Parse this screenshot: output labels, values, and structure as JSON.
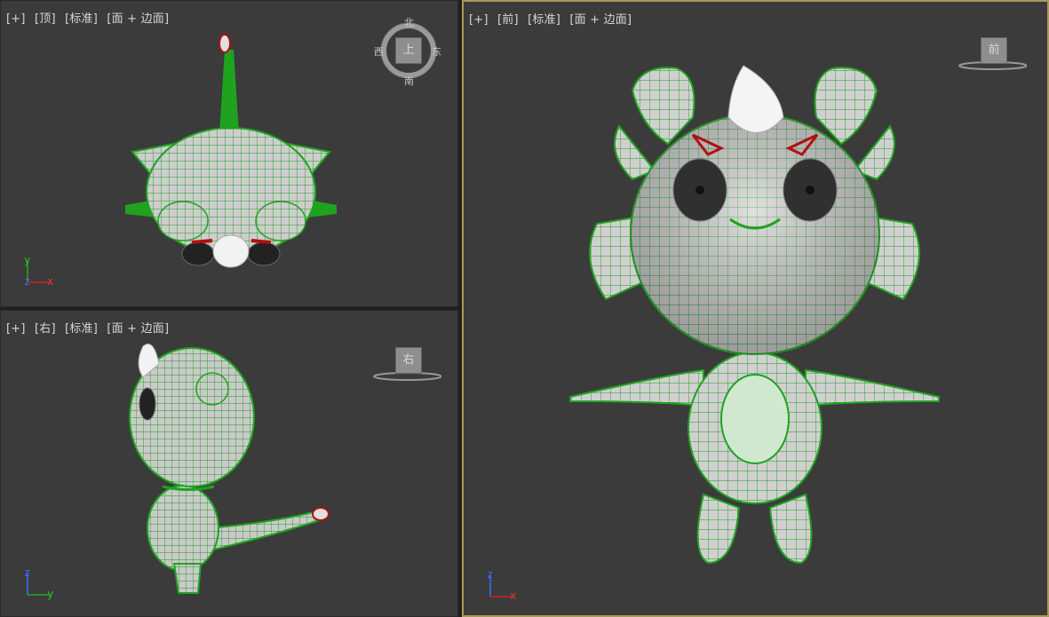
{
  "viewports": {
    "top": {
      "label_parts": [
        "[+]",
        "[顶]",
        "[标准]",
        "[面 + 边面]"
      ],
      "compass": {
        "north": "北",
        "south": "南",
        "east": "东",
        "west": "西",
        "cube": "上"
      },
      "axes": {
        "vertical": "y",
        "horizontal": "x",
        "depth": "z"
      }
    },
    "right": {
      "label_parts": [
        "[+]",
        "[右]",
        "[标准]",
        "[面 + 边面]"
      ],
      "cube": "右",
      "axes": {
        "vertical": "z",
        "horizontal": "y"
      }
    },
    "front": {
      "label_parts": [
        "[+]",
        "[前]",
        "[标准]",
        "[面 + 边面]"
      ],
      "cube": "前",
      "axes": {
        "vertical": "z",
        "horizontal": "x"
      }
    }
  },
  "colors": {
    "viewport_bg": "#3b3b3b",
    "active_border": "#a89a5a",
    "wire_green": "#1fa31f",
    "mesh_fill": "#cfcfcf",
    "eye_red": "#b01010"
  }
}
